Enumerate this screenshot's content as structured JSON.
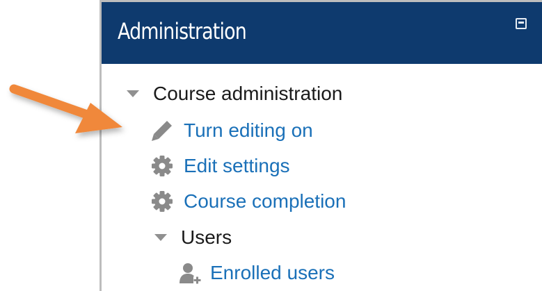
{
  "block": {
    "title": "Administration",
    "collapse_icon": "minus-square-icon"
  },
  "tree": {
    "course_admin_label": "Course administration",
    "items": [
      {
        "label": "Turn editing on",
        "icon": "pencil-icon"
      },
      {
        "label": "Edit settings",
        "icon": "gear-icon"
      },
      {
        "label": "Course completion",
        "icon": "gear-icon"
      }
    ],
    "users_label": "Users",
    "enrolled_users_label": "Enrolled users",
    "enrolled_users_icon": "user-plus-icon"
  },
  "colors": {
    "header_bg": "#0e3a6e",
    "link": "#1a70b8",
    "arrow": "#f0883a"
  }
}
